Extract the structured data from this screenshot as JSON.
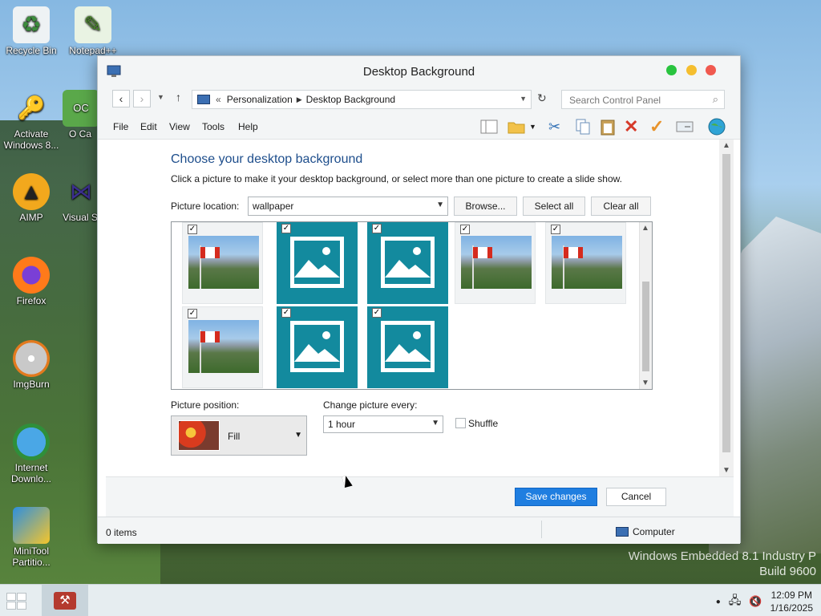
{
  "desktop": {
    "icons": [
      {
        "label": "Recycle Bin",
        "icon": "recycle-bin-icon"
      },
      {
        "label": "Notepad++",
        "icon": "notepad-plus-plus-icon"
      },
      {
        "label": "Activate Windows 8...",
        "icon": "key-shield-icon"
      },
      {
        "label": "O Ca",
        "icon": "app-green-icon"
      },
      {
        "label": "AIMP",
        "icon": "aimp-icon"
      },
      {
        "label": "Visual S",
        "icon": "visual-studio-icon"
      },
      {
        "label": "Firefox",
        "icon": "firefox-icon"
      },
      {
        "label": "ImgBurn",
        "icon": "imgburn-disc-icon"
      },
      {
        "label": "Internet Downlo...",
        "icon": "internet-download-manager-icon"
      },
      {
        "label": "MiniTool Partitio...",
        "icon": "minitool-partition-icon"
      }
    ],
    "watermark": {
      "line1": "Windows Embedded 8.1 Industry P",
      "line2": "Build 9600"
    }
  },
  "window": {
    "title": "Desktop Background",
    "address": {
      "separator": "«",
      "crumbs": [
        "Personalization",
        "Desktop Background"
      ]
    },
    "search_placeholder": "Search Control Panel",
    "menu": [
      "File",
      "Edit",
      "View",
      "Tools",
      "Help"
    ],
    "toolbar_icons": [
      "layout-pane-icon",
      "new-folder-icon",
      "dropdown-arrow-icon",
      "cut-icon",
      "copy-icon",
      "paste-icon",
      "delete-icon",
      "checkmark-icon",
      "properties-icon",
      "globe-icon"
    ],
    "colors": {
      "accent": "#1f7ee0",
      "heading": "#1e4e8c",
      "tile": "#138a9e",
      "close": "#f0594f",
      "minimize": "#f5be2f",
      "maximize": "#29c43f"
    }
  },
  "content": {
    "heading": "Choose your desktop background",
    "subtext": "Click a picture to make it your desktop background, or select more than one picture to create a slide show.",
    "picture_location_label": "Picture location:",
    "picture_location_value": "wallpaper",
    "browse": "Browse...",
    "select_all": "Select all",
    "clear_all": "Clear all",
    "pictures": [
      {
        "type": "photo",
        "checked": true
      },
      {
        "type": "placeholder",
        "checked": true
      },
      {
        "type": "placeholder",
        "checked": true
      },
      {
        "type": "photo",
        "checked": true
      },
      {
        "type": "photo",
        "checked": true
      },
      {
        "type": "photo",
        "checked": true
      },
      {
        "type": "placeholder",
        "checked": true
      },
      {
        "type": "placeholder",
        "checked": true
      }
    ],
    "picture_position_label": "Picture position:",
    "picture_position_value": "Fill",
    "change_every_label": "Change picture every:",
    "change_every_value": "1 hour",
    "shuffle_label": "Shuffle",
    "save": "Save changes",
    "cancel": "Cancel"
  },
  "status": {
    "items": "0 items",
    "location": "Computer"
  },
  "taskbar": {
    "time": "12:09 PM",
    "date": "1/16/2025"
  }
}
